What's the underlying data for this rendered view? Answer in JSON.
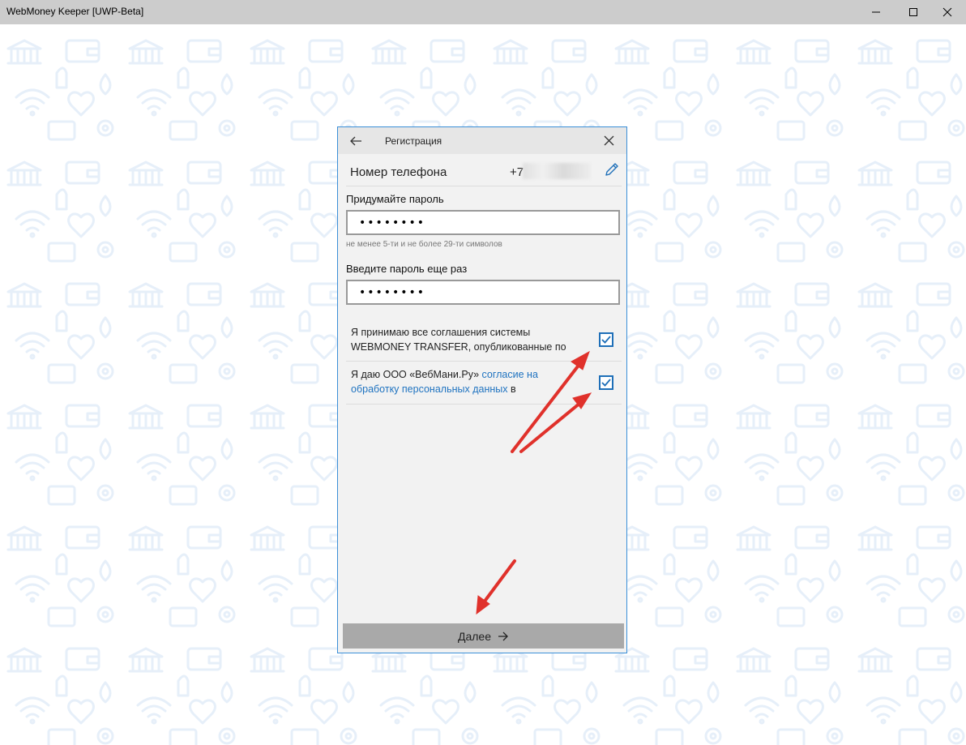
{
  "window": {
    "title": "WebMoney Keeper [UWP-Beta]",
    "controls": [
      "minimize-icon",
      "maximize-icon",
      "close-icon"
    ]
  },
  "dialog": {
    "title": "Регистрация",
    "phone": {
      "label": "Номер телефона",
      "prefix": "+7"
    },
    "password": {
      "label": "Придумайте пароль",
      "value": "••••••••",
      "hint": "не менее 5-ти и не более 29-ти символов"
    },
    "confirm": {
      "label": "Введите пароль еще раз",
      "value": "••••••••"
    },
    "agreements": [
      {
        "line1": "Я принимаю все соглашения системы",
        "line2": "WEBMONEY TRANSFER, опубликованные по",
        "checked": true
      },
      {
        "line1_prefix": "Я даю ООО «ВебМани.Ру» ",
        "line1_link": "согласие на",
        "line2_link": "обработку персональных данных",
        "line2_suffix": " в",
        "checked": true
      }
    ],
    "next_label": "Далее"
  },
  "colors": {
    "titlebar": "#cccccc",
    "accent": "#1e6fb8",
    "link": "#1f73c0",
    "annotation_arrow": "#e0312b",
    "pattern": "#e6eff9"
  }
}
